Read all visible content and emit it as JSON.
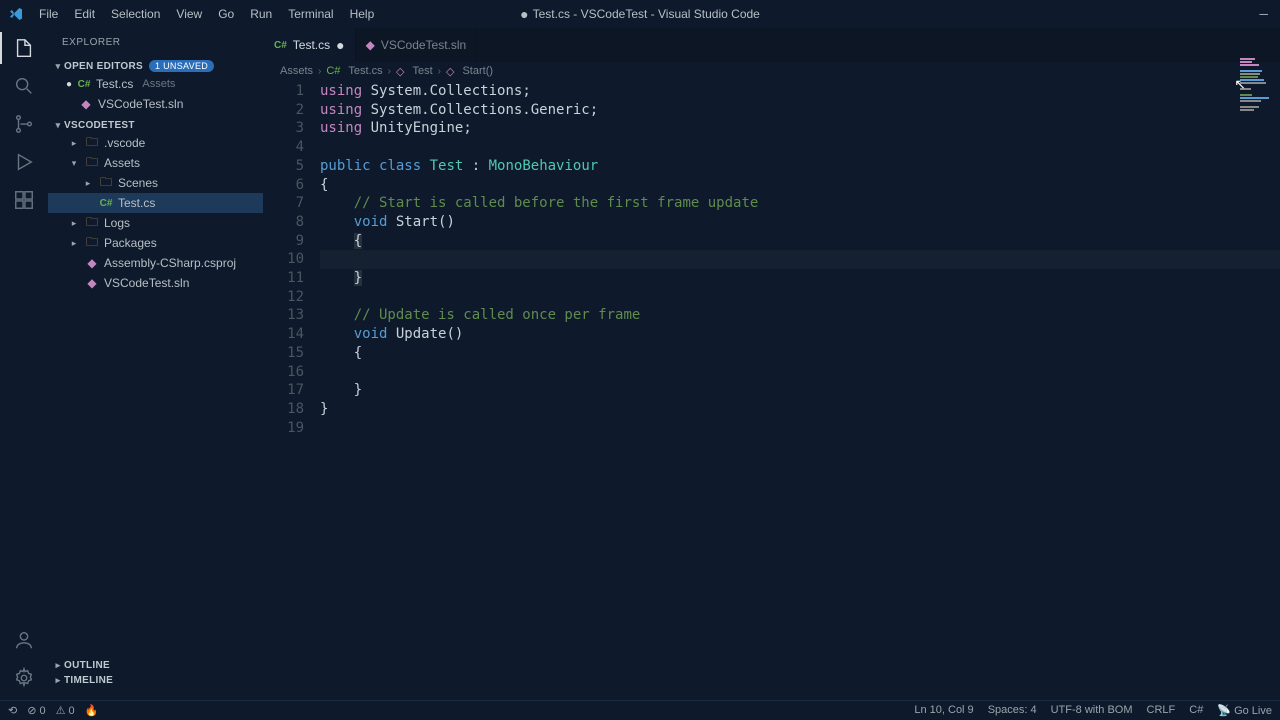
{
  "title": "Test.cs - VSCodeTest - Visual Studio Code",
  "title_dirty": "●",
  "menu": [
    "File",
    "Edit",
    "Selection",
    "View",
    "Go",
    "Run",
    "Terminal",
    "Help"
  ],
  "sidebar": {
    "header": "EXPLORER",
    "open_editors": {
      "label": "OPEN EDITORS",
      "badge": "1 UNSAVED",
      "items": [
        {
          "name": "Test.cs",
          "detail": "Assets",
          "dirty": true
        },
        {
          "name": "VSCodeTest.sln",
          "detail": "",
          "dirty": false
        }
      ]
    },
    "project": {
      "label": "VSCODETEST",
      "tree": [
        {
          "name": ".vscode",
          "type": "folder",
          "depth": 1,
          "expanded": false
        },
        {
          "name": "Assets",
          "type": "folder",
          "depth": 1,
          "expanded": true
        },
        {
          "name": "Scenes",
          "type": "folder",
          "depth": 2,
          "expanded": false
        },
        {
          "name": "Test.cs",
          "type": "cs",
          "depth": 2,
          "selected": true
        },
        {
          "name": "Logs",
          "type": "folder",
          "depth": 1,
          "expanded": false
        },
        {
          "name": "Packages",
          "type": "folder",
          "depth": 1,
          "expanded": false
        },
        {
          "name": "Assembly-CSharp.csproj",
          "type": "proj",
          "depth": 1
        },
        {
          "name": "VSCodeTest.sln",
          "type": "sln",
          "depth": 1
        }
      ]
    },
    "outline": "OUTLINE",
    "timeline": "TIMELINE"
  },
  "tabs": [
    {
      "label": "Test.cs",
      "active": true,
      "dirty": true
    },
    {
      "label": "VSCodeTest.sln",
      "active": false,
      "dirty": false
    }
  ],
  "breadcrumbs": [
    "Assets",
    "Test.cs",
    "Test",
    "Start()"
  ],
  "code": {
    "lines": [
      [
        [
          "k-using",
          "using"
        ],
        [
          "",
          " "
        ],
        [
          "k-namespace",
          "System.Collections"
        ],
        [
          "",
          ";"
        ]
      ],
      [
        [
          "k-using",
          "using"
        ],
        [
          "",
          " "
        ],
        [
          "k-namespace",
          "System.Collections.Generic"
        ],
        [
          "",
          ";"
        ]
      ],
      [
        [
          "k-using",
          "using"
        ],
        [
          "",
          " "
        ],
        [
          "k-namespace",
          "UnityEngine"
        ],
        [
          "",
          ";"
        ]
      ],
      [],
      [
        [
          "k-keyword",
          "public"
        ],
        [
          "",
          " "
        ],
        [
          "k-keyword",
          "class"
        ],
        [
          "",
          " "
        ],
        [
          "k-class",
          "Test"
        ],
        [
          "",
          " : "
        ],
        [
          "k-class",
          "MonoBehaviour"
        ]
      ],
      [
        [
          "",
          "{"
        ]
      ],
      [
        [
          "",
          "    "
        ],
        [
          "k-comment",
          "// Start is called before the first frame update"
        ]
      ],
      [
        [
          "",
          "    "
        ],
        [
          "k-keyword",
          "void"
        ],
        [
          "",
          " Start()"
        ]
      ],
      [
        [
          "",
          "    "
        ],
        [
          "k-brace-hl",
          "{"
        ]
      ],
      [
        [
          "",
          "        "
        ]
      ],
      [
        [
          "",
          "    "
        ],
        [
          "k-brace-hl",
          "}"
        ]
      ],
      [],
      [
        [
          "",
          "    "
        ],
        [
          "k-comment",
          "// Update is called once per frame"
        ]
      ],
      [
        [
          "",
          "    "
        ],
        [
          "k-keyword",
          "void"
        ],
        [
          "",
          " Update()"
        ]
      ],
      [
        [
          "",
          "    {"
        ]
      ],
      [
        [
          "",
          "        "
        ]
      ],
      [
        [
          "",
          "    }"
        ]
      ],
      [
        [
          "",
          "}"
        ]
      ],
      []
    ],
    "cursor_line": 10
  },
  "status": {
    "left": {
      "errors": "0",
      "warnings": "0"
    },
    "right": {
      "position": "Ln 10, Col 9",
      "spaces": "Spaces: 4",
      "encoding": "UTF-8 with BOM",
      "eol": "CRLF",
      "lang": "C#",
      "golive": "Go Live"
    }
  }
}
